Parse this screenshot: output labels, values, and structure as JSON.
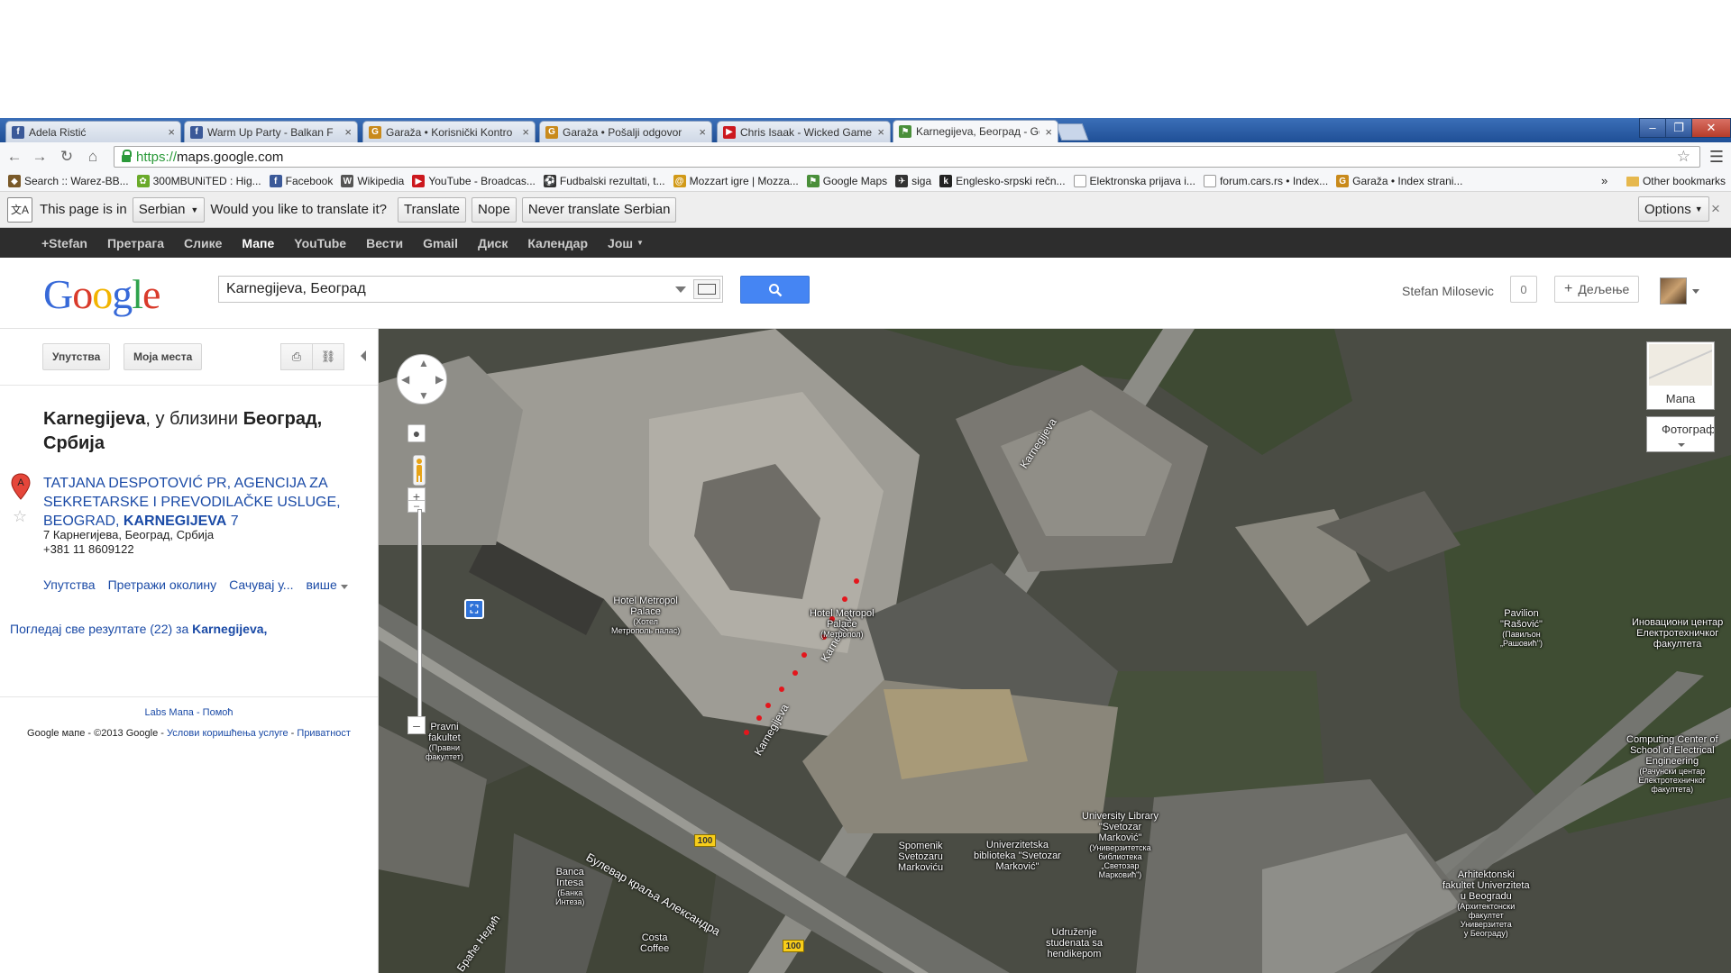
{
  "tabs": [
    {
      "title": "Adela Ristić",
      "icon": "facebook-icon",
      "color": "#3b5998",
      "glyph": "f"
    },
    {
      "title": "Warm Up Party - Balkan F",
      "icon": "facebook-icon",
      "color": "#3b5998",
      "glyph": "f"
    },
    {
      "title": "Garaža • Korisnički Kontro",
      "icon": "garaza-icon",
      "color": "#c98a1b",
      "glyph": "G"
    },
    {
      "title": "Garaža • Pošalji odgovor",
      "icon": "garaza-icon",
      "color": "#c98a1b",
      "glyph": "G"
    },
    {
      "title": "Chris Isaak - Wicked Game",
      "icon": "youtube-icon",
      "color": "#cc181e",
      "glyph": "▶"
    },
    {
      "title": "Karnegijeva, Београд - Go",
      "icon": "google-maps-icon",
      "color": "#4a8f3a",
      "glyph": "⚑",
      "active": true
    }
  ],
  "toolbar": {
    "url_scheme": "https://",
    "url_rest": "maps.google.com"
  },
  "bookmarks": [
    {
      "label": "Search :: Warez-BB...",
      "icon": "warez-icon",
      "color": "#7a5a2a",
      "glyph": "◆"
    },
    {
      "label": "300MBUNiTED : Hig...",
      "icon": "300mbunited-icon",
      "color": "#6aaa2a",
      "glyph": "✿"
    },
    {
      "label": "Facebook",
      "icon": "facebook-icon",
      "color": "#3b5998",
      "glyph": "f"
    },
    {
      "label": "Wikipedia",
      "icon": "wikipedia-icon",
      "color": "#555555",
      "glyph": "W"
    },
    {
      "label": "YouTube - Broadcas...",
      "icon": "youtube-icon",
      "color": "#cc181e",
      "glyph": "▶"
    },
    {
      "label": "Fudbalski rezultati, t...",
      "icon": "football-icon",
      "color": "#333333",
      "glyph": "⚽"
    },
    {
      "label": "Mozzart igre | Mozza...",
      "icon": "mozzart-icon",
      "color": "#d29a18",
      "glyph": "@"
    },
    {
      "label": "Google Maps",
      "icon": "google-maps-icon",
      "color": "#4a8f3a",
      "glyph": "⚑"
    },
    {
      "label": "siga",
      "icon": "siga-icon",
      "color": "#333333",
      "glyph": "✈"
    },
    {
      "label": "Englesko-srpski rečn...",
      "icon": "dictionary-icon",
      "color": "#222222",
      "glyph": "k"
    },
    {
      "label": "Elektronska prijava i...",
      "icon": "page-icon",
      "color": "#ffffff",
      "glyph": ""
    },
    {
      "label": "forum.cars.rs • Index...",
      "icon": "page-icon",
      "color": "#ffffff",
      "glyph": ""
    },
    {
      "label": "Garaža • Index strani...",
      "icon": "garaza-icon",
      "color": "#c98a1b",
      "glyph": "G"
    }
  ],
  "bookmarks_overflow": "»",
  "bookmarks_other": "Other bookmarks",
  "translate": {
    "prefix": "This page is in",
    "language": "Serbian",
    "question": "Would you like to translate it?",
    "translate_btn": "Translate",
    "nope_btn": "Nope",
    "never_btn": "Never translate Serbian",
    "options_btn": "Options",
    "close": "×"
  },
  "gbar": [
    "+Stefan",
    "Претрага",
    "Слике",
    "Мапе",
    "YouTube",
    "Вести",
    "Gmail",
    "Диск",
    "Календар",
    "Још"
  ],
  "gbar_active": "Мапе",
  "header": {
    "search_value": "Karnegijeva, Београд",
    "user": "Stefan Milosevic",
    "notif_count": "0",
    "share": "Дељење"
  },
  "left": {
    "directions_btn": "Упутства",
    "my_places_btn": "Моја места",
    "title_strong1": "Karnegijeva",
    "title_mid": ", у близини ",
    "title_strong2": "Београд",
    "title_end": ", Србија",
    "result_marker": "A",
    "result_link": "TATJANA DESPOTOVIĆ PR, AGENCIJA ZA SEKRETARSKE I PREVODILAČKE USLUGE, BEOGRAD, ",
    "result_link_bold": "KARNEGIJEVA",
    "result_link_end": " 7",
    "addr1": "7 Карнегијева, Београд, Србија",
    "addr2": "+381 11 8609122",
    "act_directions": "Упутства",
    "act_search_nearby": "Претражи околину",
    "act_save": "Сачувај у...",
    "act_more": "више",
    "all_results": "Погледај све резултате (22) за ",
    "all_results_bold": "Karnegijeva,",
    "labs": "Labs Мапа",
    "help": "Помоћ",
    "copyright": "Google мапе - ©2013 Google - ",
    "terms": "Услови коришћења услуге",
    "privacy": "Приватност"
  },
  "map": {
    "maptype_label": "Мапа",
    "sat_label": "Фотографија",
    "labels": [
      {
        "text": "Hotel Metropol\nPalace",
        "sub": "(Хотел\nМетрополь палас)"
      },
      {
        "text": "Hotel Metropol\nPalace",
        "sub": "(Метропол)"
      },
      {
        "text": "Pavilion\n\"Rašović\"",
        "sub": "(Павиљон\n„Рашовић\")"
      },
      {
        "text": "Иновациони центар\nЕлектротехничког\nфакултета",
        "sub": ""
      },
      {
        "text": "Computing Center of\nSchool of Electrical\nEngineering",
        "sub": "(Рачунски центар\nЕлектротехничког\nфакултета)"
      },
      {
        "text": "Pravni\nfakultet",
        "sub": "(Правни\nфакултет)"
      },
      {
        "text": "University Library\n\"Svetozar\nMarković\"",
        "sub": "(Универзитетска\nбиблиотека\n„Светозар\nМарковић\")"
      },
      {
        "text": "Univerzitetska\nbiblioteka \"Svetozar\nMarković\"",
        "sub": ""
      },
      {
        "text": "Spomenik\nSvetozaru\nMarkoviću",
        "sub": ""
      },
      {
        "text": "Banca\nIntesa",
        "sub": "(Банка\nИнтеза)"
      },
      {
        "text": "Costa\nCoffee",
        "sub": ""
      },
      {
        "text": "Udruženje\nstudenata sa\nhendikepom",
        "sub": ""
      },
      {
        "text": "Arhitektonski\nfakultet Univerziteta\nu Beogradu",
        "sub": "(Архитектонски\nфакултет\nУниверзитета\nу Београду)"
      }
    ],
    "streets": [
      "Karnegijeva",
      "Karnegijeva",
      "Karnegijeva",
      "Булевар краља Александра",
      "Браће Недић"
    ],
    "shield": "100"
  }
}
